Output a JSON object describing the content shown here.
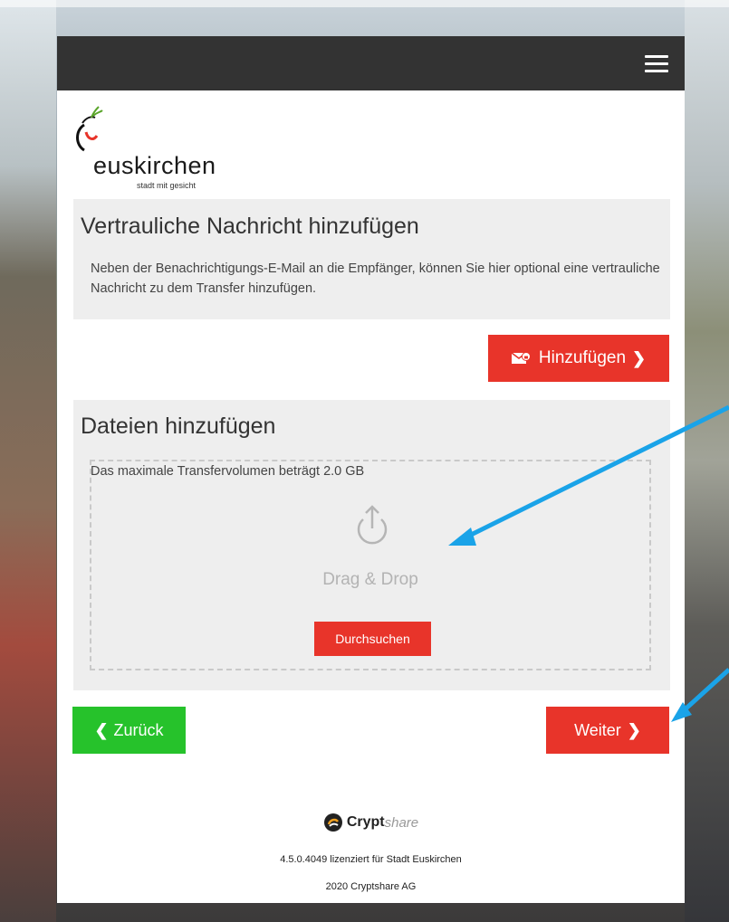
{
  "header": {
    "menu_icon": "hamburger-icon"
  },
  "logo": {
    "name": "euskirchen",
    "tagline": "stadt mit gesicht"
  },
  "message_section": {
    "title": "Vertrauliche Nachricht hinzufügen",
    "description": "Neben der Benachrichtigungs-E-Mail an die Empfänger, können Sie hier optional eine vertrauliche Nachricht zu dem Transfer hinzufügen.",
    "add_button_label": "Hinzufügen",
    "add_button_icon": "mail-lock-icon"
  },
  "files_section": {
    "title": "Dateien hinzufügen",
    "max_volume_text": "Das maximale Transfervolumen beträgt 2.0 GB",
    "dropzone_text": "Drag & Drop",
    "browse_button_label": "Durchsuchen"
  },
  "navigation": {
    "back_label": "Zurück",
    "next_label": "Weiter"
  },
  "footer": {
    "brand_bold": "Crypt",
    "brand_italic": "share",
    "version_text": "4.5.0.4049 lizenziert für Stadt Euskirchen",
    "copyright_text": "2020 Cryptshare AG"
  },
  "colors": {
    "primary_red": "#e8342a",
    "back_green": "#26c22b",
    "topbar": "#333333",
    "annotation_arrow": "#1aa3e8"
  }
}
